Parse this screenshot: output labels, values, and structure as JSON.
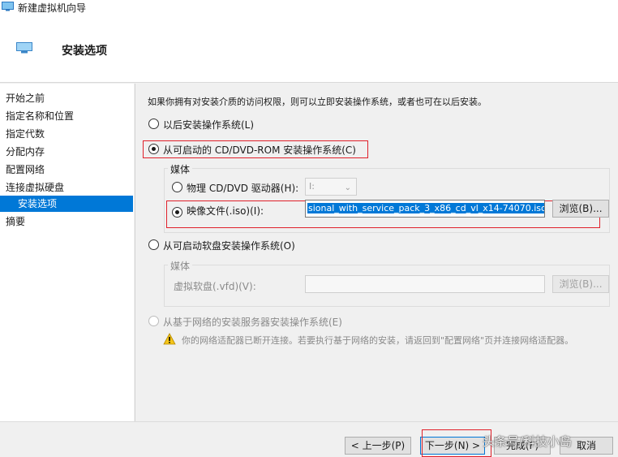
{
  "window": {
    "title": "新建虚拟机向导"
  },
  "header": {
    "title": "安装选项"
  },
  "sidebar": {
    "items": [
      {
        "label": "开始之前"
      },
      {
        "label": "指定名称和位置"
      },
      {
        "label": "指定代数"
      },
      {
        "label": "分配内存"
      },
      {
        "label": "配置网络"
      },
      {
        "label": "连接虚拟硬盘"
      },
      {
        "label": "安装选项"
      },
      {
        "label": "摘要"
      }
    ]
  },
  "main": {
    "intro": "如果你拥有对安装介质的访问权限，则可以立即安装操作系统，或者也可在以后安装。",
    "option_later": "以后安装操作系统(L)",
    "option_dvd": "从可启动的 CD/DVD-ROM 安装操作系统(C)",
    "dvd_media_legend": "媒体",
    "physical_drive": "物理 CD/DVD 驱动器(H):",
    "physical_drive_value": "I:",
    "image_file": "映像文件(.iso)(I):",
    "image_file_value": "sional_with_service_pack_3_x86_cd_vl_x14-74070.iso",
    "browse": "浏览(B)...",
    "option_floppy": "从可启动软盘安装操作系统(O)",
    "floppy_media_legend": "媒体",
    "virtual_floppy": "虚拟软盘(.vfd)(V):",
    "floppy_value": "",
    "browse_disabled": "浏览(B)...",
    "option_network": "从基于网络的安装服务器安装操作系统(E)",
    "warning": "你的网络适配器已断开连接。若要执行基于网络的安装，请返回到\"配置网络\"页并连接网络适配器。"
  },
  "footer": {
    "prev": "< 上一步(P)",
    "next": "下一步(N) >",
    "finish": "完成(F)",
    "cancel": "取消"
  },
  "watermark": "头条号/科技小岛",
  "colors": {
    "accent": "#0078d7",
    "highlight_box": "#e0202a"
  }
}
